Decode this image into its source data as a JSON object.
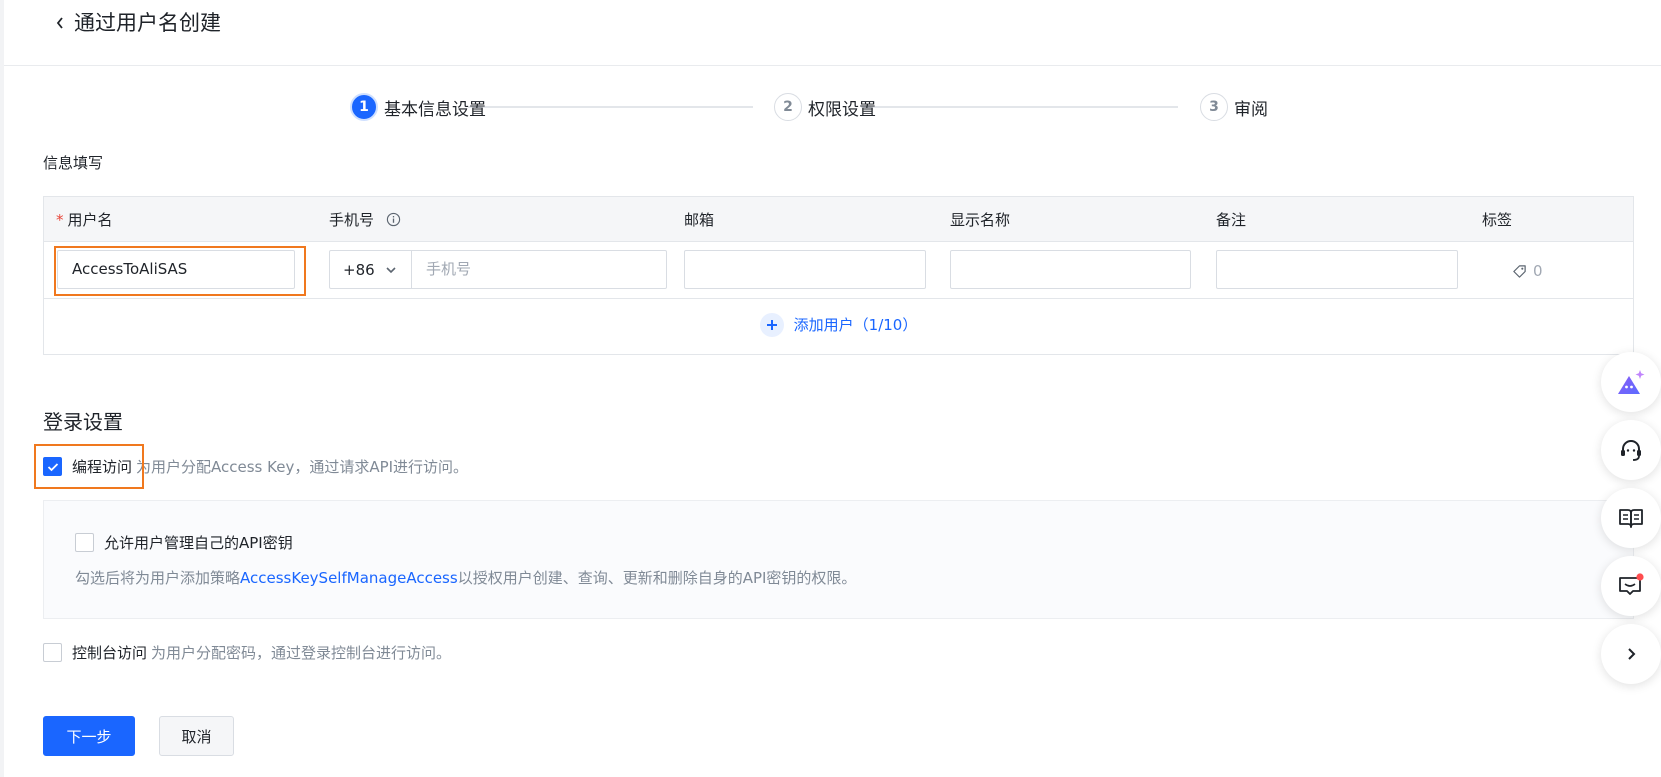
{
  "header": {
    "title": "通过用户名创建",
    "back_icon": "chevron-left-icon"
  },
  "steps": [
    {
      "num": "1",
      "label": "基本信息设置",
      "state": "active"
    },
    {
      "num": "2",
      "label": "权限设置",
      "state": "todo"
    },
    {
      "num": "3",
      "label": "审阅",
      "state": "todo"
    }
  ],
  "info_section": {
    "title": "信息填写",
    "columns": {
      "username": "用户名",
      "phone": "手机号",
      "email": "邮箱",
      "display_name": "显示名称",
      "remark": "备注",
      "tag": "标签"
    },
    "row": {
      "username_value": "AccessToAliSAS",
      "phone_code": "+86",
      "phone_placeholder": "手机号",
      "email_value": "",
      "display_name_value": "",
      "remark_value": "",
      "tag_count": "0"
    },
    "add_user_label": "添加用户（1/10）"
  },
  "login_settings": {
    "title": "登录设置",
    "programmatic": {
      "label": "编程访问",
      "desc": "为用户分配Access Key，通过请求API进行访问。",
      "checked": true
    },
    "api_key": {
      "label": "允许用户管理自己的API密钥",
      "checked": false,
      "desc_prefix": "勾选后将为用户添加策略",
      "policy_link": "AccessKeySelfManageAccess",
      "desc_suffix": "以授权用户创建、查询、更新和删除自身的API密钥的权限。"
    },
    "console": {
      "label": "控制台访问",
      "desc": "为用户分配密码，通过登录控制台进行访问。",
      "checked": false
    }
  },
  "actions": {
    "next_label": "下一步",
    "cancel_label": "取消"
  },
  "floating_toolbar": [
    "ai-assistant-icon",
    "customer-service-icon",
    "docs-book-icon",
    "feedback-message-icon",
    "chevron-right-icon"
  ],
  "colors": {
    "primary": "#1a66ff",
    "highlight": "#f0781e",
    "required": "#e8463a",
    "notification": "#ff4d4f"
  }
}
